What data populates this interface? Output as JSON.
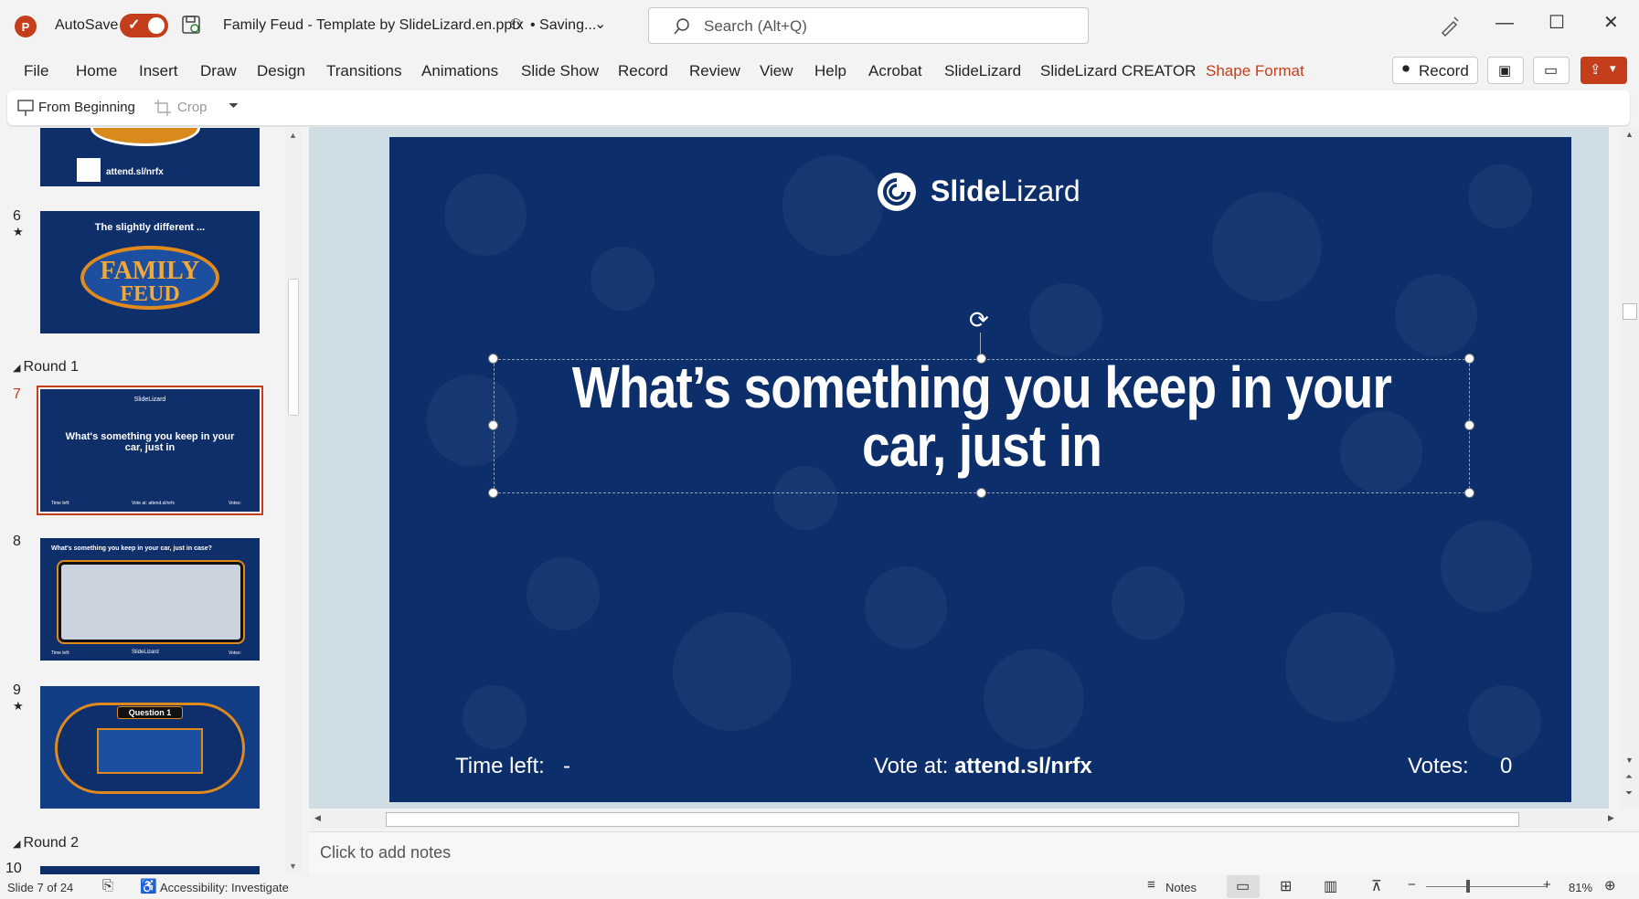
{
  "titlebar": {
    "logo": "P",
    "autosave_label": "AutoSave",
    "file_name": "Family Feud - Template by SlideLizard.en.pptx",
    "saving_status": "• Saving...",
    "search_placeholder": "Search (Alt+Q)"
  },
  "menu": {
    "items": [
      "File",
      "Home",
      "Insert",
      "Draw",
      "Design",
      "Transitions",
      "Animations",
      "Slide Show",
      "Record",
      "Review",
      "View",
      "Help",
      "Acrobat",
      "SlideLizard",
      "SlideLizard CREATOR",
      "Shape Format"
    ],
    "record_label": "Record",
    "active_color": "#c43e1c"
  },
  "ribbon": {
    "from_beginning": "From Beginning",
    "crop": "Crop"
  },
  "thumbnails": {
    "slide5": {
      "url": "attend.sl/nrfx"
    },
    "slide6": {
      "num": "6",
      "title": "The slightly different ...",
      "logo_line1": "FAMILY",
      "logo_line2": "FEUD"
    },
    "section1": "Round 1",
    "slide7": {
      "num": "7",
      "title": "What's something you keep in your car, just in",
      "brand": "SlideLizard",
      "time": "Time left:",
      "vote": "Vote at: attend.sl/nrfx",
      "votes": "Votes:"
    },
    "slide8": {
      "num": "8",
      "title": "What's something you keep in your car, just in case?",
      "time": "Time left:",
      "brand": "SlideLizard",
      "votes": "Votes:"
    },
    "slide9": {
      "num": "9",
      "title": "Question 1"
    },
    "section2": "Round 2",
    "slide10": {
      "num": "10"
    },
    "star": "★"
  },
  "slide": {
    "brand_bold": "Slide",
    "brand_light": "Lizard",
    "question_line1": "What’s something you keep in your",
    "question_line2": "car, just in",
    "time_label": "Time left:",
    "time_value": "-",
    "vote_label": "Vote at: ",
    "vote_url": "attend.sl/nrfx",
    "votes_label": "Votes:",
    "votes_value": "0",
    "bg_color": "#0c2f6b"
  },
  "notes": {
    "placeholder": "Click to add notes"
  },
  "status": {
    "slide_info": "Slide 7 of 24",
    "accessibility": "Accessibility: Investigate",
    "notes_label": "Notes",
    "zoom": "81%"
  }
}
